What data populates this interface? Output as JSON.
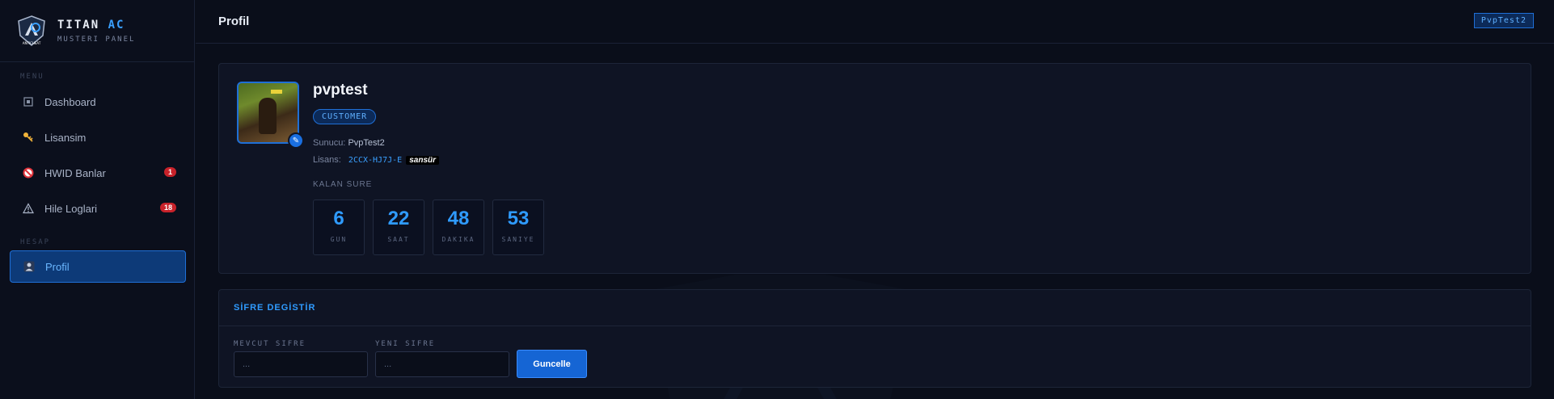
{
  "brand": {
    "title_main": "TITAN",
    "title_accent": "AC",
    "subtitle": "MUSTERI PANEL",
    "logo_text": "ANTICHEAT"
  },
  "sidebar": {
    "menu_label": "MENU",
    "account_label": "HESAP",
    "items": [
      {
        "label": "Dashboard",
        "icon": "dashboard-icon"
      },
      {
        "label": "Lisansim",
        "icon": "key-icon"
      },
      {
        "label": "HWID Banlar",
        "icon": "ban-icon",
        "badge": "1"
      },
      {
        "label": "Hile Loglari",
        "icon": "warning-icon",
        "badge": "18"
      },
      {
        "label": "Profil",
        "icon": "user-icon",
        "active": true
      }
    ]
  },
  "header": {
    "title": "Profil",
    "user_chip": "PvpTest2"
  },
  "profile": {
    "username": "pvptest",
    "role": "CUSTOMER",
    "server_label": "Sunucu:",
    "server_value": "PvpTest2",
    "license_label": "Lisans:",
    "license_value": "2CCX-HJ7J-E",
    "censor_text": "sansür",
    "remaining_label": "KALAN SURE",
    "timer": [
      {
        "value": "6",
        "unit": "GUN"
      },
      {
        "value": "22",
        "unit": "SAAT"
      },
      {
        "value": "48",
        "unit": "DAKIKA"
      },
      {
        "value": "53",
        "unit": "SANIYE"
      }
    ]
  },
  "password": {
    "title": "SİFRE DEGİSTİR",
    "current_label": "MEVCUT SIFRE",
    "current_placeholder": "...",
    "new_label": "YENI SIFRE",
    "new_placeholder": "...",
    "button_label": "Guncelle"
  },
  "colors": {
    "accent": "#2f9bff",
    "background": "#0a0e1a",
    "badge": "#c8222a"
  }
}
